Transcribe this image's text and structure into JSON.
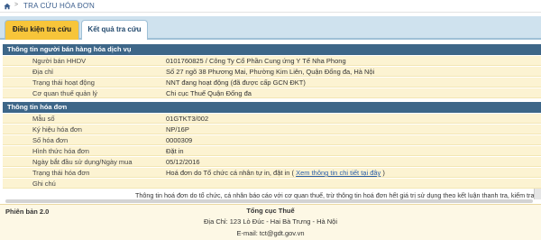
{
  "breadcrumb": {
    "separator": ">",
    "title": "TRA CỨU HÓA ĐƠN"
  },
  "tabs": [
    {
      "label": "Điều kiện tra cứu",
      "active": false
    },
    {
      "label": "Kết quả tra cứu",
      "active": true
    }
  ],
  "seller": {
    "header": "Thông tin người bán hàng hóa dịch vụ",
    "rows": [
      {
        "label": "Người bán HHDV",
        "value": "0101760825 / Công Ty Cổ Phần Cung ứng Y Tế Nha Phong"
      },
      {
        "label": "Địa chỉ",
        "value": "Số 27 ngõ 38 Phương Mai, Phường Kim Liên, Quận Đống đa, Hà Nội"
      },
      {
        "label": "Trạng thái hoạt động",
        "value": "NNT đang hoạt động (đã được cấp GCN ĐKT)"
      },
      {
        "label": "Cơ quan thuế quản lý",
        "value": "Chi cục Thuế Quận Đống đa"
      }
    ]
  },
  "invoice": {
    "header": "Thông tin hóa đơn",
    "rows": [
      {
        "label": "Mẫu số",
        "value": "01GTKT3/002"
      },
      {
        "label": "Ký hiệu hóa đơn",
        "value": "NP/16P"
      },
      {
        "label": "Số hóa đơn",
        "value": "0000309"
      },
      {
        "label": "Hình thức hóa đơn",
        "value": "Đặt in"
      },
      {
        "label": "Ngày bắt đầu sử dụng/Ngày mua",
        "value": "05/12/2016"
      },
      {
        "label": "Trạng thái hóa đơn",
        "value": "Hoá đơn do Tổ chức cá nhân tự in, đặt in (",
        "link": "Xem thông tin chi tiết tại đây",
        "suffix": ")"
      },
      {
        "label": "Ghi chú",
        "value": ""
      }
    ]
  },
  "notice": "Thông tin hoá đơn do tổ chức, cá nhân báo cáo với cơ quan thuế, trừ thông tin hoá đơn hết giá trị sử dụng theo kết luận thanh tra, kiểm tra",
  "footer": {
    "version": "Phiên bản 2.0",
    "org_name": "Tổng cục Thuế",
    "address": "Địa Chỉ: 123 Lò Đúc - Hai Bà Trưng - Hà Nội",
    "email": "E-mail: tct@gdt.gov.vn"
  },
  "colors": {
    "section_header": "#3d6688",
    "row_background": "#fcf3d2",
    "active_tab": "#f7c53a",
    "tab_strip": "#cfe2ee"
  }
}
